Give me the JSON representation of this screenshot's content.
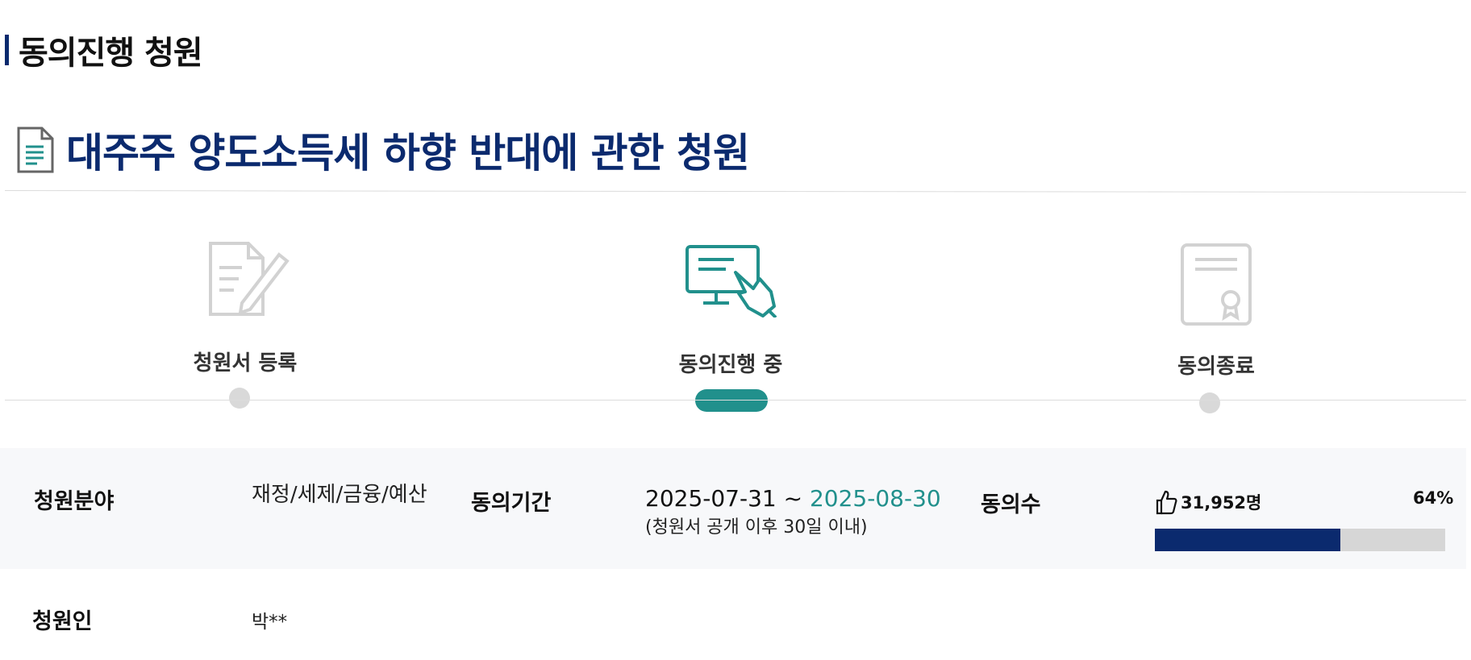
{
  "section": {
    "title": "동의진행 청원"
  },
  "petition": {
    "title": "대주주 양도소득세 하향 반대에 관한 청원"
  },
  "steps": [
    {
      "label": "청원서 등록",
      "state": "done",
      "icon": "petition-write-icon"
    },
    {
      "label": "동의진행 중",
      "state": "active",
      "icon": "monitor-click-icon"
    },
    {
      "label": "동의종료",
      "state": "pending",
      "icon": "certificate-icon"
    }
  ],
  "info": {
    "field_label": "청원분야",
    "field_value": "재정/세제/금융/예산",
    "period_label": "동의기간",
    "period_start": "2025-07-31 ~ ",
    "period_end": "2025-08-30",
    "period_note": "(청원서 공개 이후 30일 이내)",
    "count_label": "동의수",
    "count_value": "31,952명",
    "percent_text": "64%",
    "progress_fraction": 0.64,
    "petitioner_label": "청원인",
    "petitioner_value": "박**"
  },
  "colors": {
    "navy": "#0b2a6e",
    "teal": "#21908c",
    "gray": "#d9d9d9"
  }
}
